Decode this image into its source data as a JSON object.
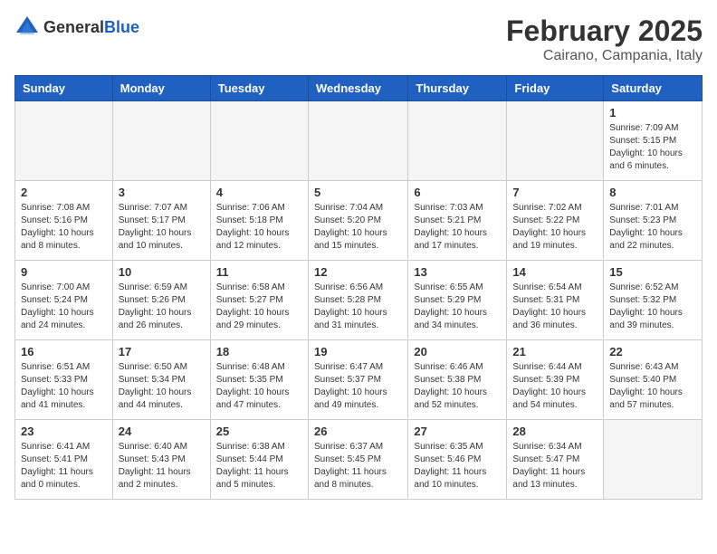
{
  "logo": {
    "general": "General",
    "blue": "Blue"
  },
  "header": {
    "month": "February 2025",
    "location": "Cairano, Campania, Italy"
  },
  "days_of_week": [
    "Sunday",
    "Monday",
    "Tuesday",
    "Wednesday",
    "Thursday",
    "Friday",
    "Saturday"
  ],
  "weeks": [
    [
      {
        "day": "",
        "info": ""
      },
      {
        "day": "",
        "info": ""
      },
      {
        "day": "",
        "info": ""
      },
      {
        "day": "",
        "info": ""
      },
      {
        "day": "",
        "info": ""
      },
      {
        "day": "",
        "info": ""
      },
      {
        "day": "1",
        "info": "Sunrise: 7:09 AM\nSunset: 5:15 PM\nDaylight: 10 hours and 6 minutes."
      }
    ],
    [
      {
        "day": "2",
        "info": "Sunrise: 7:08 AM\nSunset: 5:16 PM\nDaylight: 10 hours and 8 minutes."
      },
      {
        "day": "3",
        "info": "Sunrise: 7:07 AM\nSunset: 5:17 PM\nDaylight: 10 hours and 10 minutes."
      },
      {
        "day": "4",
        "info": "Sunrise: 7:06 AM\nSunset: 5:18 PM\nDaylight: 10 hours and 12 minutes."
      },
      {
        "day": "5",
        "info": "Sunrise: 7:04 AM\nSunset: 5:20 PM\nDaylight: 10 hours and 15 minutes."
      },
      {
        "day": "6",
        "info": "Sunrise: 7:03 AM\nSunset: 5:21 PM\nDaylight: 10 hours and 17 minutes."
      },
      {
        "day": "7",
        "info": "Sunrise: 7:02 AM\nSunset: 5:22 PM\nDaylight: 10 hours and 19 minutes."
      },
      {
        "day": "8",
        "info": "Sunrise: 7:01 AM\nSunset: 5:23 PM\nDaylight: 10 hours and 22 minutes."
      }
    ],
    [
      {
        "day": "9",
        "info": "Sunrise: 7:00 AM\nSunset: 5:24 PM\nDaylight: 10 hours and 24 minutes."
      },
      {
        "day": "10",
        "info": "Sunrise: 6:59 AM\nSunset: 5:26 PM\nDaylight: 10 hours and 26 minutes."
      },
      {
        "day": "11",
        "info": "Sunrise: 6:58 AM\nSunset: 5:27 PM\nDaylight: 10 hours and 29 minutes."
      },
      {
        "day": "12",
        "info": "Sunrise: 6:56 AM\nSunset: 5:28 PM\nDaylight: 10 hours and 31 minutes."
      },
      {
        "day": "13",
        "info": "Sunrise: 6:55 AM\nSunset: 5:29 PM\nDaylight: 10 hours and 34 minutes."
      },
      {
        "day": "14",
        "info": "Sunrise: 6:54 AM\nSunset: 5:31 PM\nDaylight: 10 hours and 36 minutes."
      },
      {
        "day": "15",
        "info": "Sunrise: 6:52 AM\nSunset: 5:32 PM\nDaylight: 10 hours and 39 minutes."
      }
    ],
    [
      {
        "day": "16",
        "info": "Sunrise: 6:51 AM\nSunset: 5:33 PM\nDaylight: 10 hours and 41 minutes."
      },
      {
        "day": "17",
        "info": "Sunrise: 6:50 AM\nSunset: 5:34 PM\nDaylight: 10 hours and 44 minutes."
      },
      {
        "day": "18",
        "info": "Sunrise: 6:48 AM\nSunset: 5:35 PM\nDaylight: 10 hours and 47 minutes."
      },
      {
        "day": "19",
        "info": "Sunrise: 6:47 AM\nSunset: 5:37 PM\nDaylight: 10 hours and 49 minutes."
      },
      {
        "day": "20",
        "info": "Sunrise: 6:46 AM\nSunset: 5:38 PM\nDaylight: 10 hours and 52 minutes."
      },
      {
        "day": "21",
        "info": "Sunrise: 6:44 AM\nSunset: 5:39 PM\nDaylight: 10 hours and 54 minutes."
      },
      {
        "day": "22",
        "info": "Sunrise: 6:43 AM\nSunset: 5:40 PM\nDaylight: 10 hours and 57 minutes."
      }
    ],
    [
      {
        "day": "23",
        "info": "Sunrise: 6:41 AM\nSunset: 5:41 PM\nDaylight: 11 hours and 0 minutes."
      },
      {
        "day": "24",
        "info": "Sunrise: 6:40 AM\nSunset: 5:43 PM\nDaylight: 11 hours and 2 minutes."
      },
      {
        "day": "25",
        "info": "Sunrise: 6:38 AM\nSunset: 5:44 PM\nDaylight: 11 hours and 5 minutes."
      },
      {
        "day": "26",
        "info": "Sunrise: 6:37 AM\nSunset: 5:45 PM\nDaylight: 11 hours and 8 minutes."
      },
      {
        "day": "27",
        "info": "Sunrise: 6:35 AM\nSunset: 5:46 PM\nDaylight: 11 hours and 10 minutes."
      },
      {
        "day": "28",
        "info": "Sunrise: 6:34 AM\nSunset: 5:47 PM\nDaylight: 11 hours and 13 minutes."
      },
      {
        "day": "",
        "info": ""
      }
    ]
  ]
}
